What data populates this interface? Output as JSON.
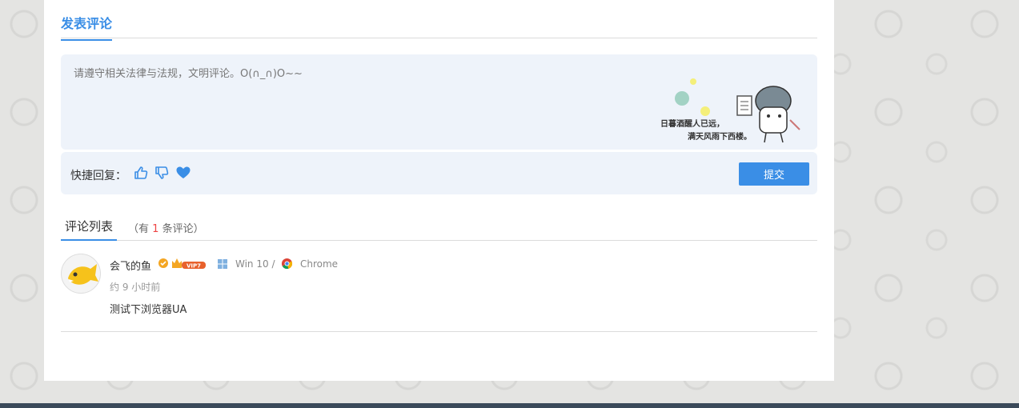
{
  "post_section": {
    "title": "发表评论",
    "placeholder": "请遵守相关法律与法规，文明评论。O(∩_∩)O~~",
    "quick_reply_label": "快捷回复：",
    "quick_icons": [
      "thumbs-up-icon",
      "thumbs-down-icon",
      "heart-icon"
    ],
    "submit_label": "提交",
    "decoration_text_line1": "日暮酒醒人已远，",
    "decoration_text_line2": "满天风雨下西楼。"
  },
  "comments_section": {
    "title": "评论列表",
    "count_prefix": "（有",
    "count": "1",
    "count_suffix": "条评论）"
  },
  "comments": [
    {
      "author": "会飞的鱼",
      "vip_label": "VIP7",
      "os": "Win 10 /",
      "browser": "Chrome",
      "time": "约 9 小时前",
      "content": "测试下浏览器UA"
    }
  ],
  "colors": {
    "accent": "#3a8ee6",
    "panel": "#eef3fa",
    "count": "#ee4444"
  }
}
